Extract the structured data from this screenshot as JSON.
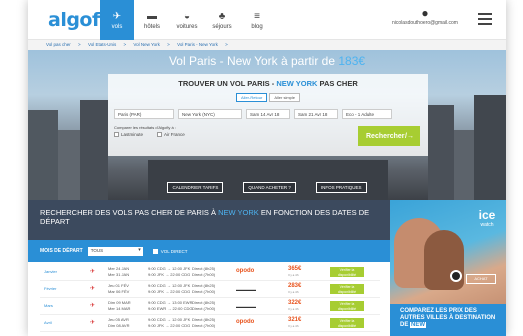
{
  "header": {
    "logo": "algofly",
    "nav": [
      {
        "label": "vols",
        "icon": "plane-icon",
        "active": true
      },
      {
        "label": "hôtels",
        "icon": "bed-icon",
        "active": false
      },
      {
        "label": "voitures",
        "icon": "car-icon",
        "active": false
      },
      {
        "label": "séjours",
        "icon": "palm-icon",
        "active": false
      },
      {
        "label": "blog",
        "icon": "blog-icon",
        "active": false
      }
    ],
    "user_email": "nicolasdouthoero@gmail.com"
  },
  "breadcrumb": [
    "Vol pas cher",
    ">",
    "Vol Etats-Unis",
    ">",
    "Vol New York",
    ">",
    "Vol Paris - New York",
    ">"
  ],
  "hero": {
    "title_prefix": "Vol Paris - New York à partir de",
    "title_price": "183€",
    "search_title_prefix": "TROUVER UN VOL PARIS -",
    "search_title_dest": "NEW YORK",
    "search_title_suffix": "PAS CHER",
    "trip_types": [
      "Aller-Retour",
      "Aller simple"
    ],
    "fields": {
      "from": "Paris (PAR)",
      "to": "New York (NYC)",
      "depart": "Sam 14 Avr 18",
      "return": "Sam 21 Avr 18",
      "passengers": "Eco - 1 Adulte"
    },
    "compare_label": "Comparer les résultats d'Algofly à :",
    "compare_options": [
      "Lastminute",
      "Air France"
    ],
    "search_button": "Rechercher",
    "links": [
      "CALENDRIER TARIFS",
      "QUAND ACHETER ?",
      "INFOS PRATIQUES"
    ]
  },
  "section": {
    "title_prefix": "RECHERCHER DES VOLS PAS CHER DE PARIS À",
    "title_dest": "NEW YORK",
    "title_suffix": "EN FONCTION DES DATES DE DÉPART",
    "filter_label": "MOIS DE DÉPART",
    "filter_value": "TOUS",
    "direct_label": "VOL DIRECT"
  },
  "deals": [
    {
      "month": "Janvier",
      "dates": [
        "Mer 24 JAN",
        "Mer 31 JAN"
      ],
      "times": [
        "9:00 CDG → 12:00 JFK",
        "9:00 JFK → 22:00 CDG"
      ],
      "type": [
        "Direct (8h25)",
        "Direct (7h00)"
      ],
      "agency": "opodo",
      "price": "365€",
      "price_note": "Il y a 4h",
      "cta": "Vérifier la disponibilité"
    },
    {
      "month": "Février",
      "dates": [
        "Jeu 01 FÉV",
        "Mar 06 FÉV"
      ],
      "times": [
        "9:00 CDG → 12:00 JFK",
        "9:00 JFK → 22:00 CDG"
      ],
      "type": [
        "Direct (8h25)",
        "Direct (7h00)"
      ],
      "agency": "bar",
      "price": "283€",
      "price_note": "Il y a 4h",
      "cta": "Vérifier la disponibilité"
    },
    {
      "month": "Mars",
      "dates": [
        "Dim 09 MAR",
        "Mer 14 MAR"
      ],
      "times": [
        "9:00 CDG → 13:00 EWR",
        "9:00 EWR → 22:00 CDG"
      ],
      "type": [
        "Direct (8h25)",
        "Direct (7h00)"
      ],
      "agency": "bar",
      "price": "322€",
      "price_note": "Il y a 4h",
      "cta": "Vérifier la disponibilité"
    },
    {
      "month": "Avril",
      "dates": [
        "Jeu 05 AVR",
        "Dim 08 AVR"
      ],
      "times": [
        "9:00 CDG → 12:00 JFK",
        "9:00 JFK → 22:00 CDG"
      ],
      "type": [
        "Direct (8h25)",
        "Direct (7h00)"
      ],
      "agency": "opodo",
      "price": "321€",
      "price_note": "Il y a 4h",
      "cta": "Vérifier la disponibilité"
    }
  ],
  "ad": {
    "brand": "ice",
    "brand_sub": "watch",
    "buy_label": "ACHAT",
    "compare_prefix": "COMPAREZ LES PRIX DES AUTRES VILLES À DESTINATION DE",
    "compare_dest": "NEW"
  }
}
